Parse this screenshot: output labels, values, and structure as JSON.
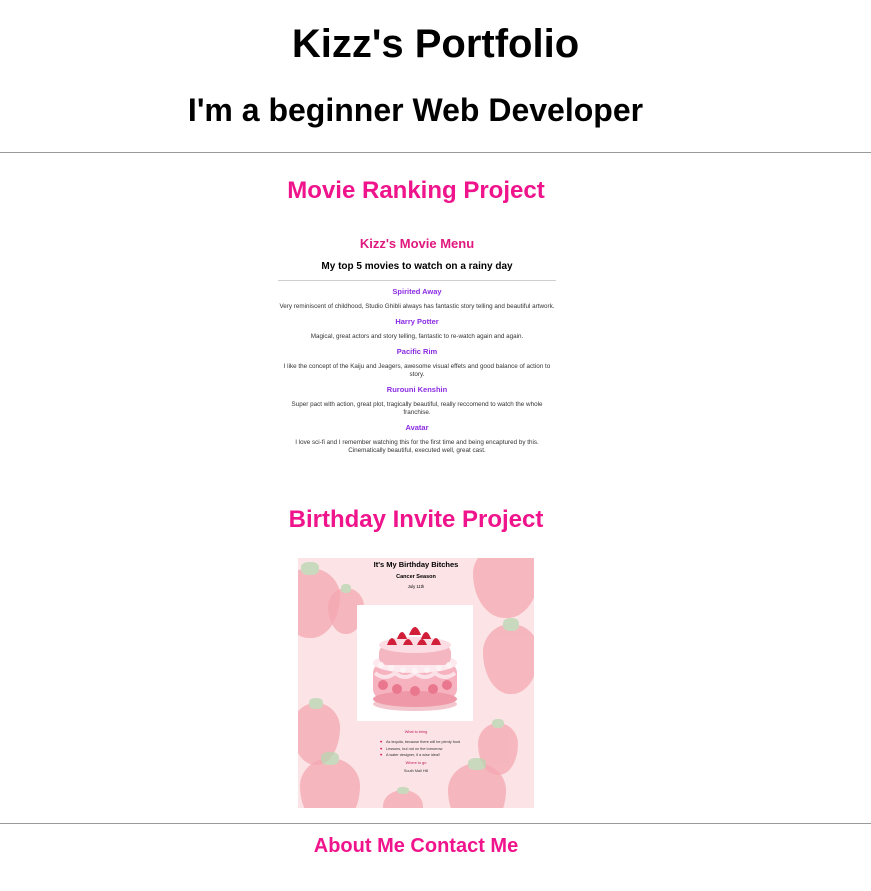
{
  "header": {
    "title": "Kizz's Portfolio",
    "subtitle": "I'm a beginner Web Developer"
  },
  "projects": [
    {
      "title": "Movie Ranking Project",
      "preview": {
        "title": "Kizz's Movie Menu",
        "subtitle": "My top 5 movies to watch on a rainy day",
        "movies": [
          {
            "name": "Spirited Away",
            "desc": "Very reminiscent of childhood, Studio Ghibli always has fantastic story telling and beautiful artwork."
          },
          {
            "name": "Harry Potter",
            "desc": "Magical, great actors and story telling, fantastic to re-watch again and again."
          },
          {
            "name": "Pacific Rim",
            "desc": "I like the concept of the Kaiju and Jeagers, awesome visual effets and good balance of action to story."
          },
          {
            "name": "Rurouni Kenshin",
            "desc": "Super pact with action, great plot, tragically beautiful, really reccomend to watch the whole franchise."
          },
          {
            "name": "Avatar",
            "desc": "I love sci-fi and I remember watching this for the first time and being encaptured by this. Cinematically beautiful, executed well, great cast."
          }
        ]
      }
    },
    {
      "title": "Birthday Invite Project",
      "preview": {
        "title": "It's My Birthday Bitches",
        "subtitle": "Cancer Season",
        "date": "July 11th",
        "when_label": "What to bring",
        "bring_list": [
          "As tequila, because there will be plenty food",
          "Lessons, but not on the tomorrow",
          "A water designer, if a wise idea!!"
        ],
        "where_label": "Where to go",
        "where": "South Mall Hill"
      }
    }
  ],
  "footer": {
    "about": "About Me",
    "contact": "Contact Me"
  },
  "colors": {
    "accent": "#f0148c",
    "movie_title": "#e0197e",
    "movie_name": "#8a2be2",
    "rule": "#9a9a9a"
  }
}
